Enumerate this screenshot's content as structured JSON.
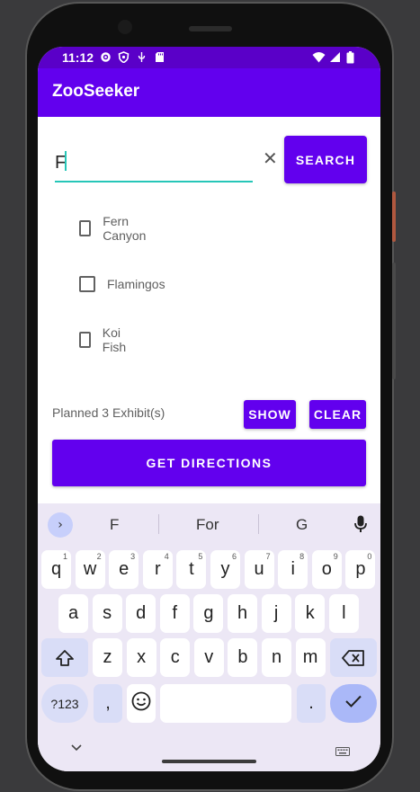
{
  "status_bar": {
    "time": "11:12"
  },
  "app_bar": {
    "title": "ZooSeeker"
  },
  "search": {
    "value": "F",
    "clear_glyph": "✕",
    "button_label": "SEARCH"
  },
  "results": [
    {
      "label": "Fern Canyon",
      "checked": false
    },
    {
      "label": "Flamingos",
      "checked": false
    },
    {
      "label": "Koi Fish",
      "checked": false
    }
  ],
  "planned_text": "Planned 3 Exhibit(s)",
  "buttons": {
    "show": "SHOW",
    "clear": "CLEAR",
    "directions": "GET DIRECTIONS"
  },
  "keyboard": {
    "expand_glyph": "›",
    "suggestions": [
      "F",
      "For",
      "G"
    ],
    "row1": [
      {
        "k": "q",
        "h": "1"
      },
      {
        "k": "w",
        "h": "2"
      },
      {
        "k": "e",
        "h": "3"
      },
      {
        "k": "r",
        "h": "4"
      },
      {
        "k": "t",
        "h": "5"
      },
      {
        "k": "y",
        "h": "6"
      },
      {
        "k": "u",
        "h": "7"
      },
      {
        "k": "i",
        "h": "8"
      },
      {
        "k": "o",
        "h": "9"
      },
      {
        "k": "p",
        "h": "0"
      }
    ],
    "row2": [
      "a",
      "s",
      "d",
      "f",
      "g",
      "h",
      "j",
      "k",
      "l"
    ],
    "row3": [
      "z",
      "x",
      "c",
      "v",
      "b",
      "n",
      "m"
    ],
    "symbols_label": "?123",
    "comma": ",",
    "period": ".",
    "emoji_icon": "smiley-icon",
    "enter_icon": "checkmark-icon"
  },
  "colors": {
    "primary": "#6200ee",
    "status_bar": "#5a00c8",
    "accent": "#26c6b8"
  }
}
